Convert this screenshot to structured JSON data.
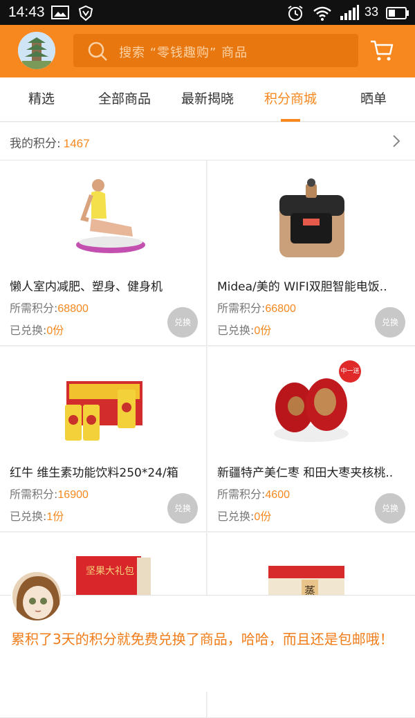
{
  "status_bar": {
    "time": "14:43",
    "battery": "33"
  },
  "header": {
    "search_placeholder": "搜索 “零钱趣购” 商品"
  },
  "tabs": [
    {
      "label": "精选"
    },
    {
      "label": "全部商品"
    },
    {
      "label": "最新揭晓"
    },
    {
      "label": "积分商城",
      "active": true
    },
    {
      "label": "晒单"
    }
  ],
  "points": {
    "label": "我的积分:",
    "value": "1467"
  },
  "labels": {
    "required": "所需积分:",
    "exchanged": "已兑换:",
    "exchange_button": "兑换"
  },
  "products": [
    {
      "name": "懒人室内减肥、塑身、健身机",
      "points": "68800",
      "exchanged": "0份",
      "icon": "fitness-machine-image"
    },
    {
      "name": "Midea/美的 WIFI双胆智能电饭..",
      "points": "66800",
      "exchanged": "0份",
      "icon": "rice-cooker-image"
    },
    {
      "name": "红牛 维生素功能饮料250*24/箱",
      "points": "16900",
      "exchanged": "1份",
      "icon": "red-bull-box-image"
    },
    {
      "name": "新疆特产美仁枣 和田大枣夹核桃..",
      "points": "4600",
      "exchanged": "0份",
      "icon": "dates-walnut-image",
      "badge": "中一送一"
    },
    {
      "name": "",
      "icon": "gift-box-image",
      "box_text": "坚果大礼包"
    },
    {
      "name": "",
      "icon": "snack-box-image",
      "box_text": "蒸"
    }
  ],
  "comment": {
    "text": "累积了3天的积分就免费兑换了商品，哈哈，而且还是包邮哦！"
  },
  "colors": {
    "accent": "#f6881f",
    "header": "#f6881f"
  }
}
